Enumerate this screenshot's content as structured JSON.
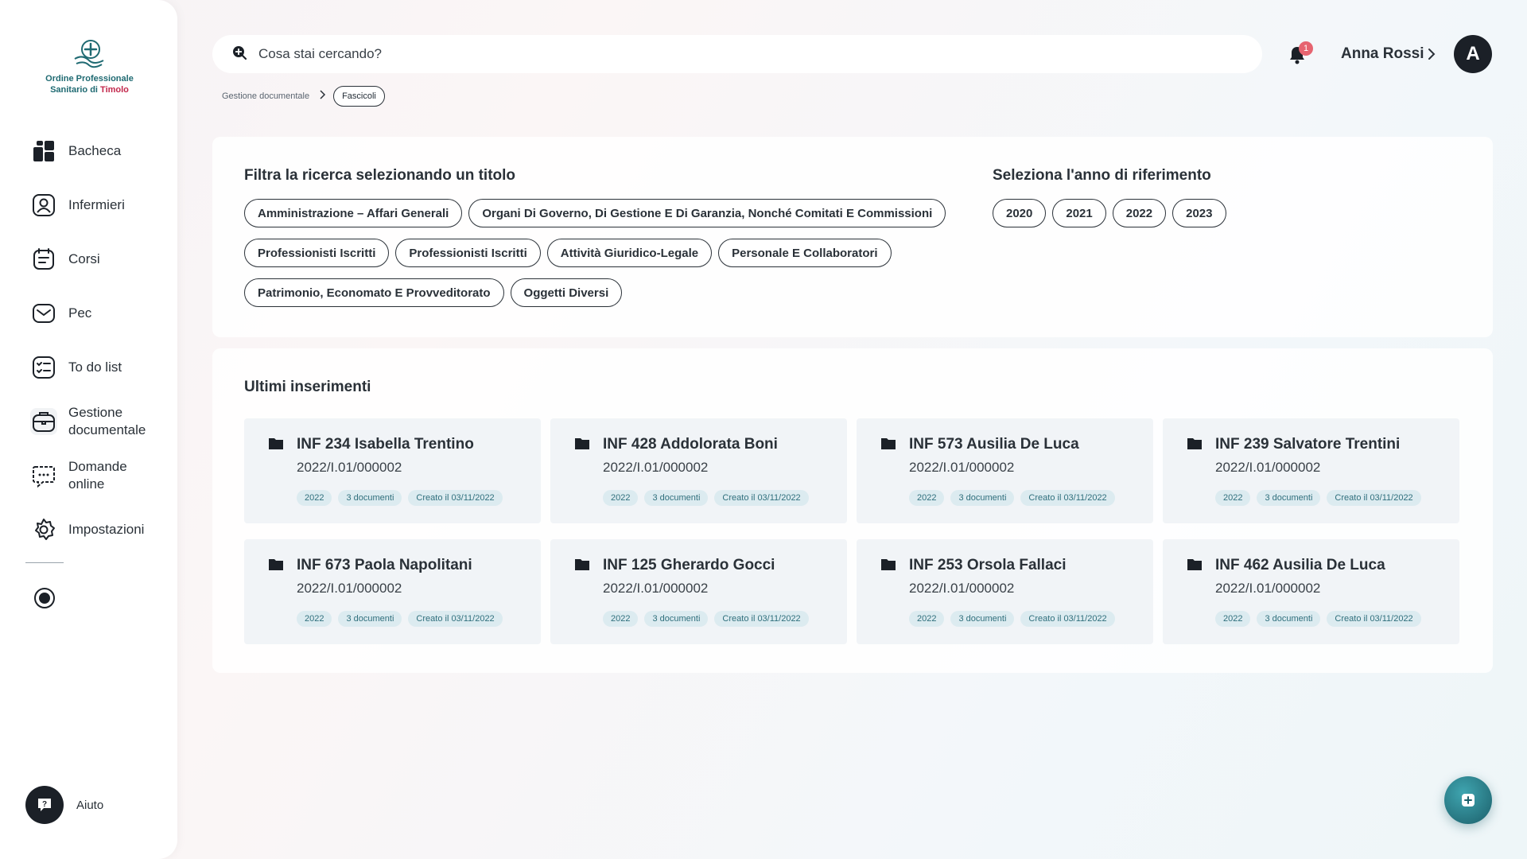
{
  "app": {
    "logo_line1": "Ordine Professionale",
    "logo_line2_prefix": "Sanitario di ",
    "logo_line2_accent": "Timolo"
  },
  "sidebar": {
    "items": [
      {
        "label": "Bacheca",
        "icon": "dashboard-icon"
      },
      {
        "label": "Infermieri",
        "icon": "user-icon"
      },
      {
        "label": "Corsi",
        "icon": "course-icon"
      },
      {
        "label": "Pec",
        "icon": "mail-icon"
      },
      {
        "label": "To do list",
        "icon": "checklist-icon"
      },
      {
        "label": "Gestione documentale",
        "icon": "briefcase-icon"
      },
      {
        "label": "Domande online",
        "icon": "chat-icon"
      },
      {
        "label": "Impostazioni",
        "icon": "gear-icon"
      }
    ],
    "help_label": "Aiuto"
  },
  "header": {
    "search_placeholder": "Cosa stai cercando?",
    "notification_count": "1",
    "user_name": "Anna Rossi",
    "avatar_initial": "A"
  },
  "breadcrumb": {
    "parent": "Gestione documentale",
    "current": "Fascicoli"
  },
  "filter": {
    "title_heading": "Filtra la ricerca selezionando un titolo",
    "titles": [
      "Amministrazione – Affari Generali",
      "Organi Di Governo, Di Gestione E Di Garanzia, Nonché Comitati E Commissioni",
      "Professionisti Iscritti",
      "Professionisti Iscritti",
      "Attività Giuridico-Legale",
      "Personale E Collaboratori",
      "Patrimonio, Economato E Provveditorato",
      "Oggetti Diversi"
    ],
    "year_heading": "Seleziona l'anno di riferimento",
    "years": [
      "2020",
      "2021",
      "2022",
      "2023"
    ]
  },
  "latest": {
    "heading": "Ultimi inserimenti",
    "cards": [
      {
        "title": "INF 234  Isabella Trentino",
        "code": "2022/I.01/000002",
        "year": "2022",
        "docs": "3 documenti",
        "created": "Creato il 03/11/2022"
      },
      {
        "title": "INF 428 Addolorata Boni",
        "code": "2022/I.01/000002",
        "year": "2022",
        "docs": "3 documenti",
        "created": "Creato il 03/11/2022"
      },
      {
        "title": "INF 573 Ausilia De Luca",
        "code": "2022/I.01/000002",
        "year": "2022",
        "docs": "3 documenti",
        "created": "Creato il 03/11/2022"
      },
      {
        "title": "INF 239 Salvatore Trentini",
        "code": "2022/I.01/000002",
        "year": "2022",
        "docs": "3 documenti",
        "created": "Creato il 03/11/2022"
      },
      {
        "title": "INF 673 Paola Napolitani",
        "code": "2022/I.01/000002",
        "year": "2022",
        "docs": "3 documenti",
        "created": "Creato il 03/11/2022"
      },
      {
        "title": "INF 125 Gherardo Gocci",
        "code": "2022/I.01/000002",
        "year": "2022",
        "docs": "3 documenti",
        "created": "Creato il 03/11/2022"
      },
      {
        "title": "INF 253 Orsola Fallaci",
        "code": "2022/I.01/000002",
        "year": "2022",
        "docs": "3 documenti",
        "created": "Creato il 03/11/2022"
      },
      {
        "title": "INF 462 Ausilia De Luca",
        "code": "2022/I.01/000002",
        "year": "2022",
        "docs": "3 documenti",
        "created": "Creato il 03/11/2022"
      }
    ]
  },
  "colors": {
    "accent": "#1f6a72",
    "brand_red": "#c2274b",
    "dark": "#1b2027",
    "tag_bg": "#dcebf0",
    "badge": "#e66470"
  }
}
